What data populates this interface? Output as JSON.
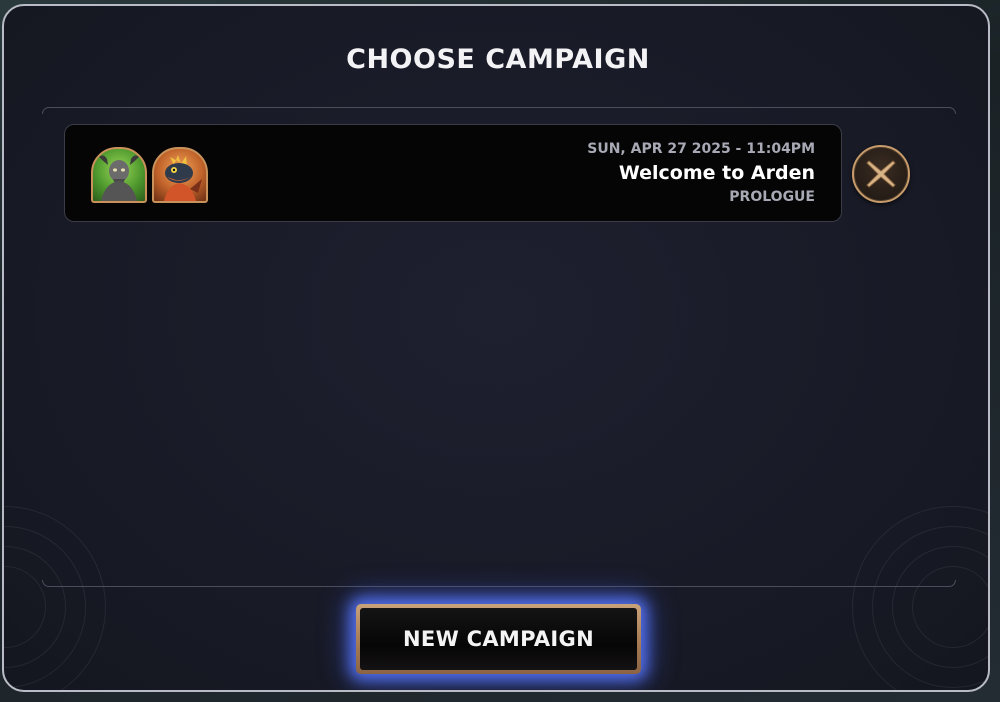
{
  "modal": {
    "title": "CHOOSE CAMPAIGN"
  },
  "campaigns": [
    {
      "date": "SUN, APR 27 2025 - 11:04PM",
      "title": "Welcome to Arden",
      "chapter": "PROLOGUE",
      "portraits": [
        {
          "icon": "goat-creature-portrait-icon",
          "frame_color": "#4f9a2e"
        },
        {
          "icon": "fire-lizard-portrait-icon",
          "frame_color": "#c0622a"
        }
      ]
    }
  ],
  "actions": {
    "delete_icon": "close-x-icon",
    "new_campaign_label": "NEW CAMPAIGN"
  },
  "colors": {
    "modal_bg": "#181a26",
    "card_bg": "#050506",
    "accent_bronze": "#c79c6a",
    "button_glow": "#5878ff"
  }
}
